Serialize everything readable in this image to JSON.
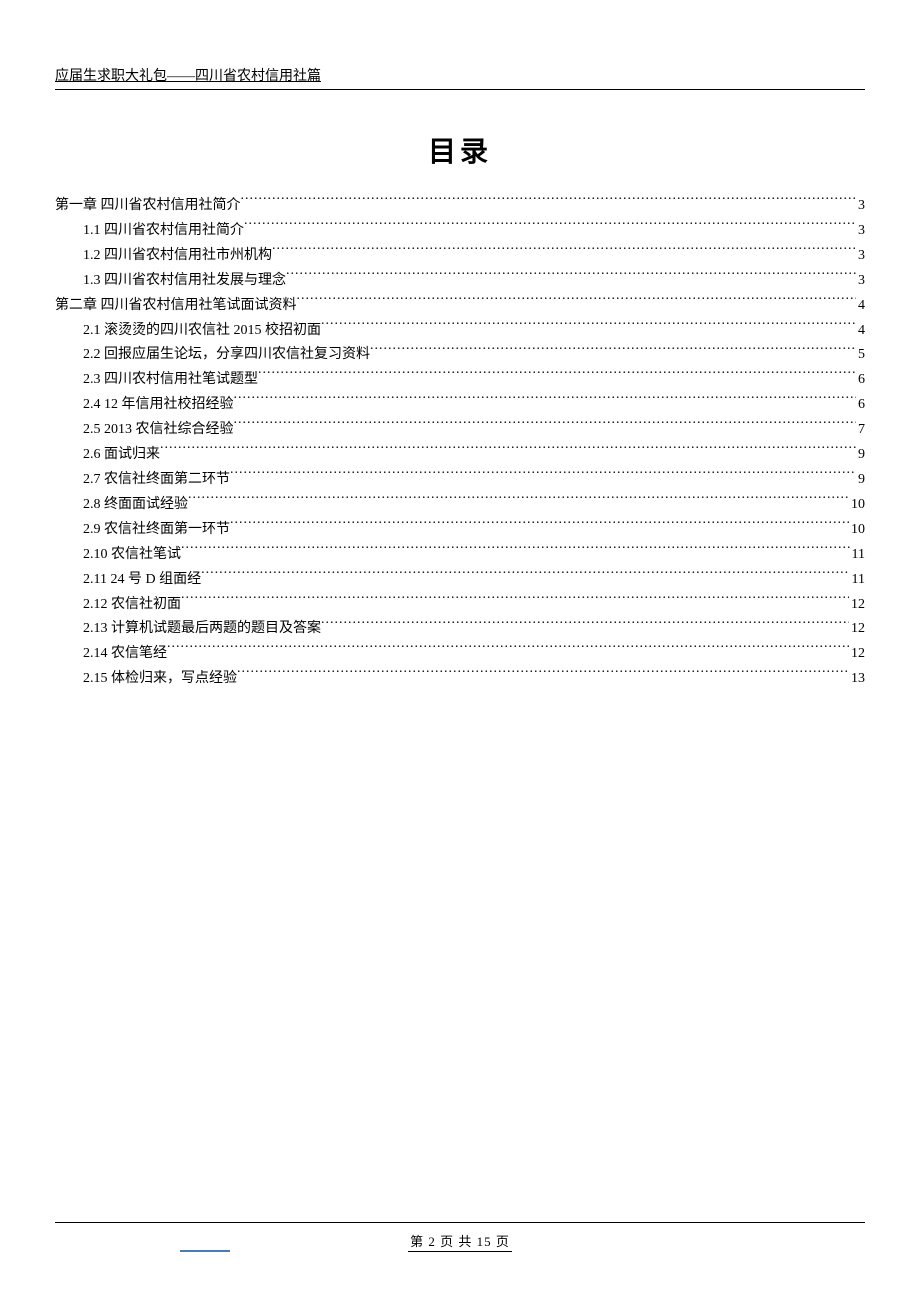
{
  "header": {
    "text": "应届生求职大礼包——四川省农村信用社篇"
  },
  "title": "目录",
  "toc": [
    {
      "level": 1,
      "label": "第一章   四川省农村信用社简介",
      "page": "3"
    },
    {
      "level": 2,
      "label": "1.1 四川省农村信用社简介",
      "page": "3"
    },
    {
      "level": 2,
      "label": "1.2 四川省农村信用社市州机构",
      "page": "3"
    },
    {
      "level": 2,
      "label": "1.3  四川省农村信用社发展与理念",
      "page": "3"
    },
    {
      "level": 1,
      "label": "第二章   四川省农村信用社笔试面试资料",
      "page": "4"
    },
    {
      "level": 2,
      "label": "2.1  滚烫烫的四川农信社 2015 校招初面",
      "page": "4"
    },
    {
      "level": 2,
      "label": "2.2  回报应届生论坛，分享四川农信社复习资料",
      "page": "5"
    },
    {
      "level": 2,
      "label": "2.3  四川农村信用社笔试题型",
      "page": "6"
    },
    {
      "level": 2,
      "label": "2.4 12 年信用社校招经验",
      "page": "6"
    },
    {
      "level": 2,
      "label": "2.5 2013 农信社综合经验",
      "page": "7"
    },
    {
      "level": 2,
      "label": "2.6  面试归来",
      "page": "9"
    },
    {
      "level": 2,
      "label": "2.7  农信社终面第二环节",
      "page": "9"
    },
    {
      "level": 2,
      "label": "2.8  终面面试经验",
      "page": "10"
    },
    {
      "level": 2,
      "label": "2.9  农信社终面第一环节",
      "page": "10"
    },
    {
      "level": 2,
      "label": "2.10  农信社笔试",
      "page": "11"
    },
    {
      "level": 2,
      "label": "2.11  24 号 D 组面经",
      "page": "11"
    },
    {
      "level": 2,
      "label": "2.12  农信社初面",
      "page": "12"
    },
    {
      "level": 2,
      "label": "2.13  计算机试题最后两题的题目及答案",
      "page": "12"
    },
    {
      "level": 2,
      "label": "2.14  农信笔经",
      "page": "12"
    },
    {
      "level": 2,
      "label": "2.15  体检归来，写点经验",
      "page": "13"
    }
  ],
  "footer": {
    "text": "第 2 页 共 15 页"
  }
}
